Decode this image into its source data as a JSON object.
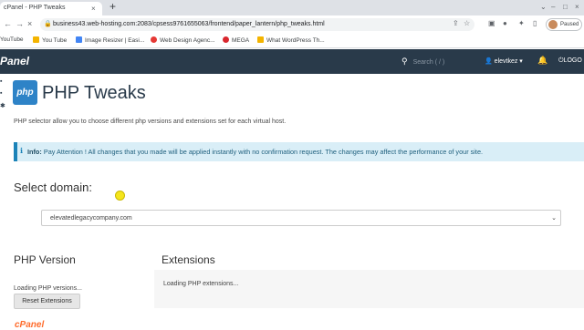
{
  "browser": {
    "tab_title": "cPanel - PHP Tweaks",
    "tab_close": "×",
    "new_tab": "+",
    "url": "business43.web-hosting.com:2083/cpsess9761655063/frontend/paper_lantern/php_tweaks.html",
    "profile_label": "Paused",
    "bookmarks": [
      {
        "label": "YouTube",
        "color": "#ff0000"
      },
      {
        "label": "You Tube",
        "color": "#f4b400"
      },
      {
        "label": "Image Resizer | Easi...",
        "color": "#4285f4"
      },
      {
        "label": "Web Design Agenc...",
        "color": "#e53935"
      },
      {
        "label": "MEGA",
        "color": "#d9272e"
      },
      {
        "label": "What WordPress Th...",
        "color": "#f4b400"
      }
    ]
  },
  "cpanel": {
    "logo": "Panel",
    "search_placeholder": "Search ( / )",
    "user": "elevtkez",
    "logout": "LOGO"
  },
  "page": {
    "icon_text": "php",
    "title": "PHP Tweaks",
    "description": "PHP selector allow you to choose different php versions and extensions set for each virtual host.",
    "alert_label": "Info:",
    "alert_text": "Pay Attention ! All changes that you made will be applied instantly with no confirmation request. The changes may affect the performance of your site.",
    "select_domain_label": "Select domain:",
    "domain_value": "elevatedlegacycompany.com",
    "php_version_label": "PHP Version",
    "extensions_label": "Extensions",
    "loading_versions": "Loading PHP versions...",
    "loading_extensions": "Loading PHP extensions...",
    "reset_button": "Reset Extensions",
    "footer_logo": "cPanel"
  },
  "colors": {
    "header_bg": "#293a4a",
    "accent": "#2e83c7",
    "alert_bg": "#d9eef7",
    "alert_border": "#1b83b8",
    "cursor_highlight": "#f5e51c"
  }
}
